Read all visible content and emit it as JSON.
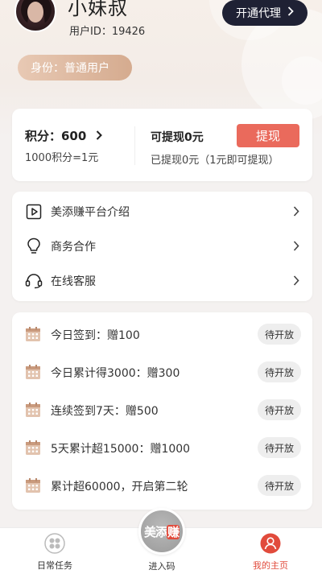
{
  "profile": {
    "nickname": "小妹叔",
    "user_id": "用户ID：19426",
    "identity": "身份：普通用户",
    "agent_button": "开通代理"
  },
  "wallet": {
    "points": "积分：600",
    "rate": "1000积分=1元",
    "withdrawable": "可提现0元",
    "withdrawn": "已提现0元（1元即可提现）",
    "withdraw_button": "提现"
  },
  "menu": {
    "items": [
      {
        "label": "美添赚平台介绍",
        "icon": "play-icon"
      },
      {
        "label": "商务合作",
        "icon": "lightbulb-icon"
      },
      {
        "label": "在线客服",
        "icon": "headset-icon"
      }
    ]
  },
  "tasks": {
    "items": [
      {
        "label": "今日签到：赠100",
        "status": "待开放"
      },
      {
        "label": "今日累计得3000：赠300",
        "status": "待开放"
      },
      {
        "label": "连续签到7天：赠500",
        "status": "待开放"
      },
      {
        "label": "5天累计超15000：赠1000",
        "status": "待开放"
      },
      {
        "label": "累计超60000，开启第二轮",
        "status": "待开放"
      }
    ]
  },
  "tabbar": {
    "left": "日常任务",
    "center": "进入码",
    "center_logo_a": "美添",
    "center_logo_b": "赚",
    "right": "我的主页"
  },
  "colors": {
    "accent": "#e14b3c",
    "withdraw": "#ea6a5c",
    "agent_bg": "#1f2134",
    "identity_bg": "#d5ab8f"
  }
}
